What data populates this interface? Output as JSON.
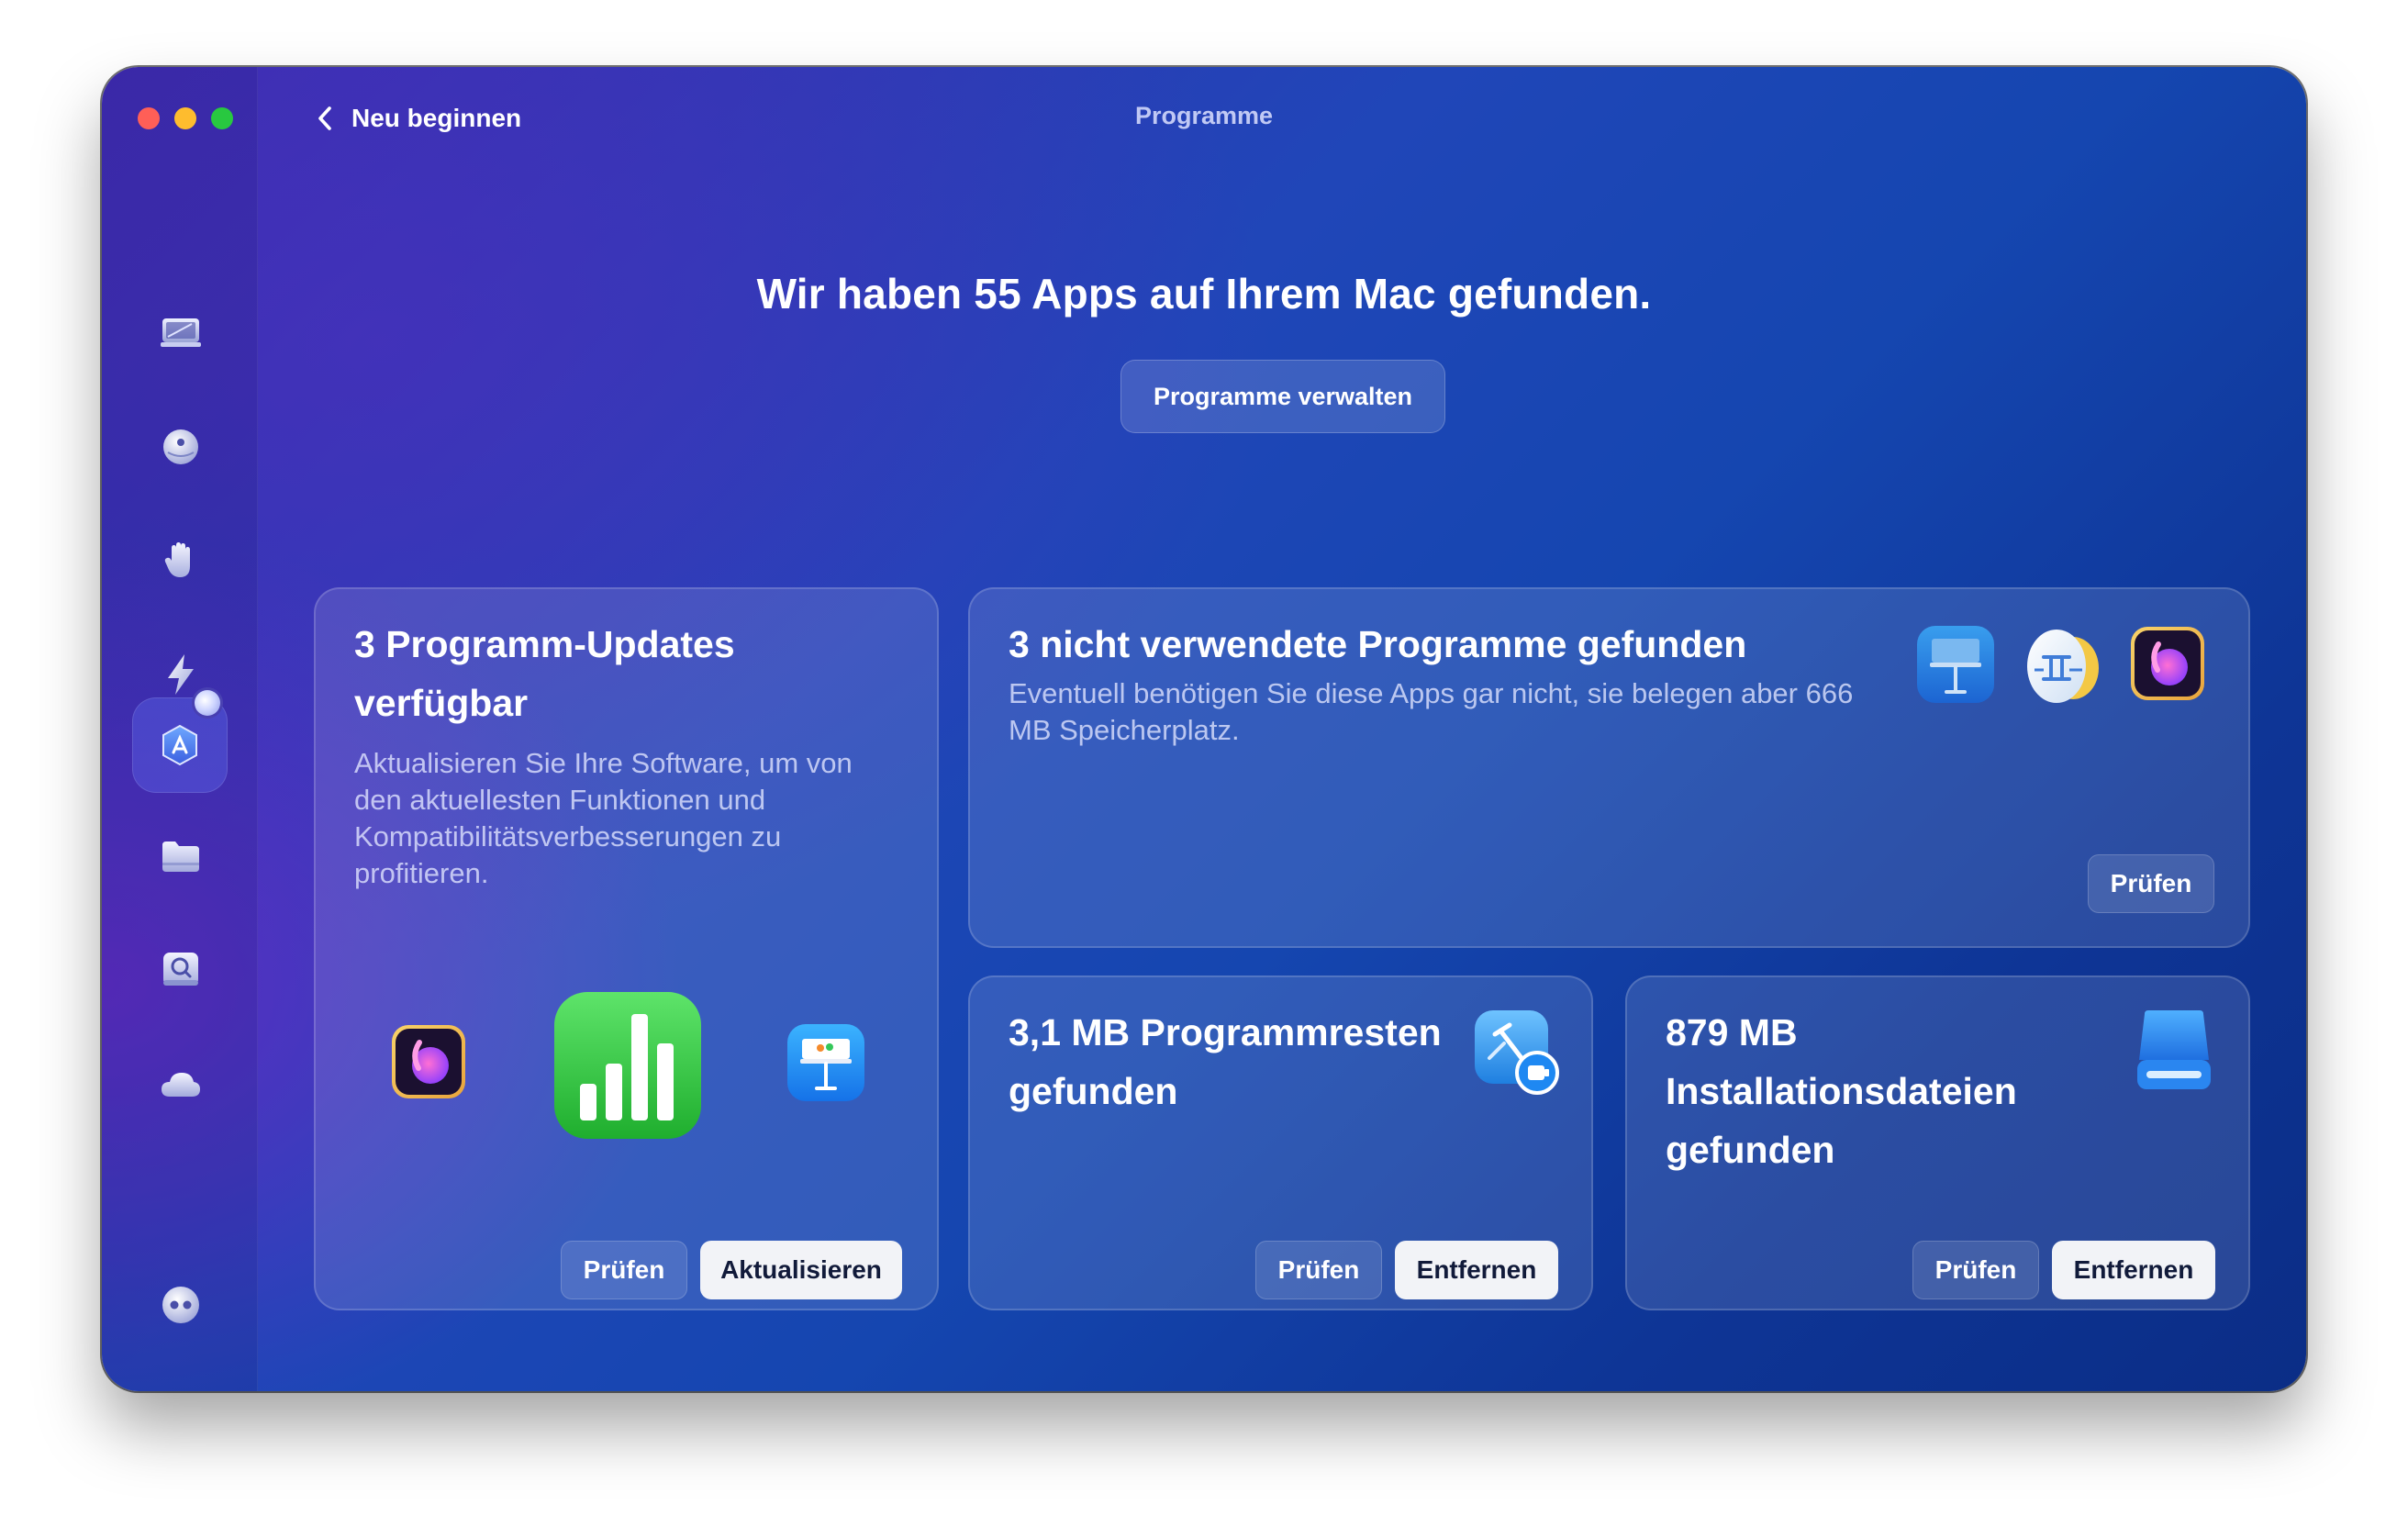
{
  "window": {
    "title": "Programme"
  },
  "nav": {
    "back_label": "Neu beginnen"
  },
  "sidebar": {
    "items": [
      {
        "name": "smart-care",
        "icon": "monitor-icon"
      },
      {
        "name": "cleanup",
        "icon": "disk-icon"
      },
      {
        "name": "protection",
        "icon": "hand-icon"
      },
      {
        "name": "performance",
        "icon": "lightning-icon"
      },
      {
        "name": "applications",
        "icon": "app-store-icon",
        "active": true
      },
      {
        "name": "my-clutter",
        "icon": "folder-icon"
      },
      {
        "name": "space-lens",
        "icon": "magnifier-icon"
      },
      {
        "name": "cloud-cleanup",
        "icon": "cloud-icon"
      },
      {
        "name": "assistant",
        "icon": "assistant-icon"
      }
    ]
  },
  "main": {
    "headline": "Wir haben 55 Apps auf Ihrem Mac gefunden.",
    "manage_button": "Programme verwalten"
  },
  "cards": {
    "updates": {
      "title_line1": "3 Programm-Updates",
      "title_line2": "verfügbar",
      "description": "Aktualisieren Sie Ihre Software, um von den aktuellesten Funktionen und Kompatibilitätsverbesserungen zu profitieren.",
      "review_label": "Prüfen",
      "action_label": "Aktualisieren",
      "icons": [
        "photo-app-icon",
        "numbers-icon",
        "keynote-icon"
      ]
    },
    "unused": {
      "title": "3 nicht verwendete Programme gefunden",
      "description": "Eventuell benötigen Sie diese Apps gar nicht, sie belegen aber 666 MB Speicherplatz.",
      "review_label": "Prüfen",
      "icons": [
        "keynote-icon",
        "gemini-icon",
        "photo-app-icon"
      ]
    },
    "leftovers": {
      "title_line1": "3,1 MB Programmresten",
      "title_line2": "gefunden",
      "review_label": "Prüfen",
      "action_label": "Entfernen",
      "icon": "xcode-plugin-icon"
    },
    "installers": {
      "title_line1": "879 MB",
      "title_line2": "Installationsdateien",
      "title_line3": "gefunden",
      "review_label": "Prüfen",
      "action_label": "Entfernen",
      "icon": "drive-icon"
    }
  },
  "colors": {
    "accent": "#2046b8",
    "traffic_red": "#ff5f57",
    "traffic_yellow": "#febc2e",
    "traffic_green": "#28c840"
  }
}
